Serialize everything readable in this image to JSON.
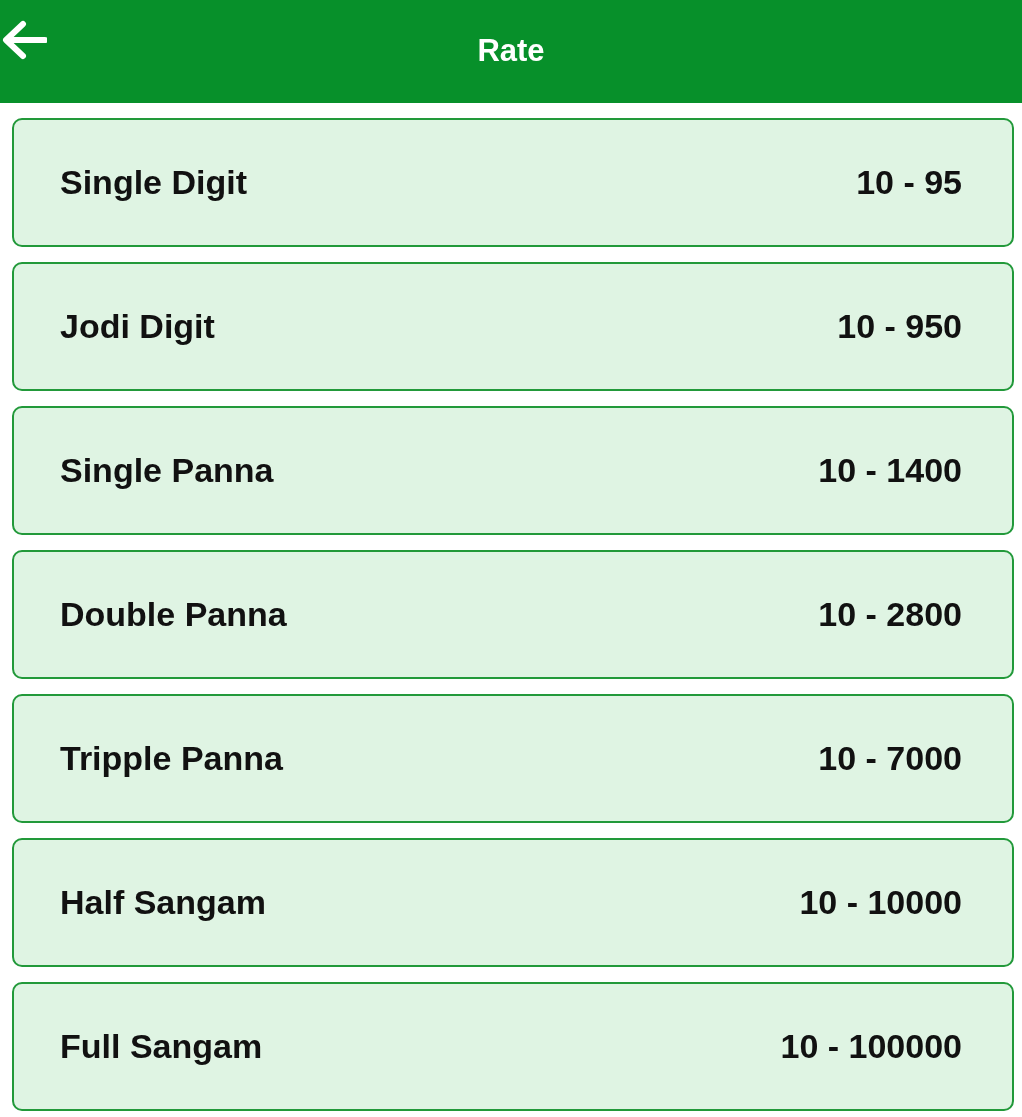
{
  "header": {
    "title": "Rate"
  },
  "rates": [
    {
      "game": "Single Digit",
      "rate": "10 - 95"
    },
    {
      "game": "Jodi Digit",
      "rate": "10 - 950"
    },
    {
      "game": "Single Panna",
      "rate": "10 - 1400"
    },
    {
      "game": "Double Panna",
      "rate": "10 - 2800"
    },
    {
      "game": "Tripple Panna",
      "rate": "10 - 7000"
    },
    {
      "game": "Half Sangam",
      "rate": "10 - 10000"
    },
    {
      "game": "Full Sangam",
      "rate": "10 - 100000"
    }
  ]
}
